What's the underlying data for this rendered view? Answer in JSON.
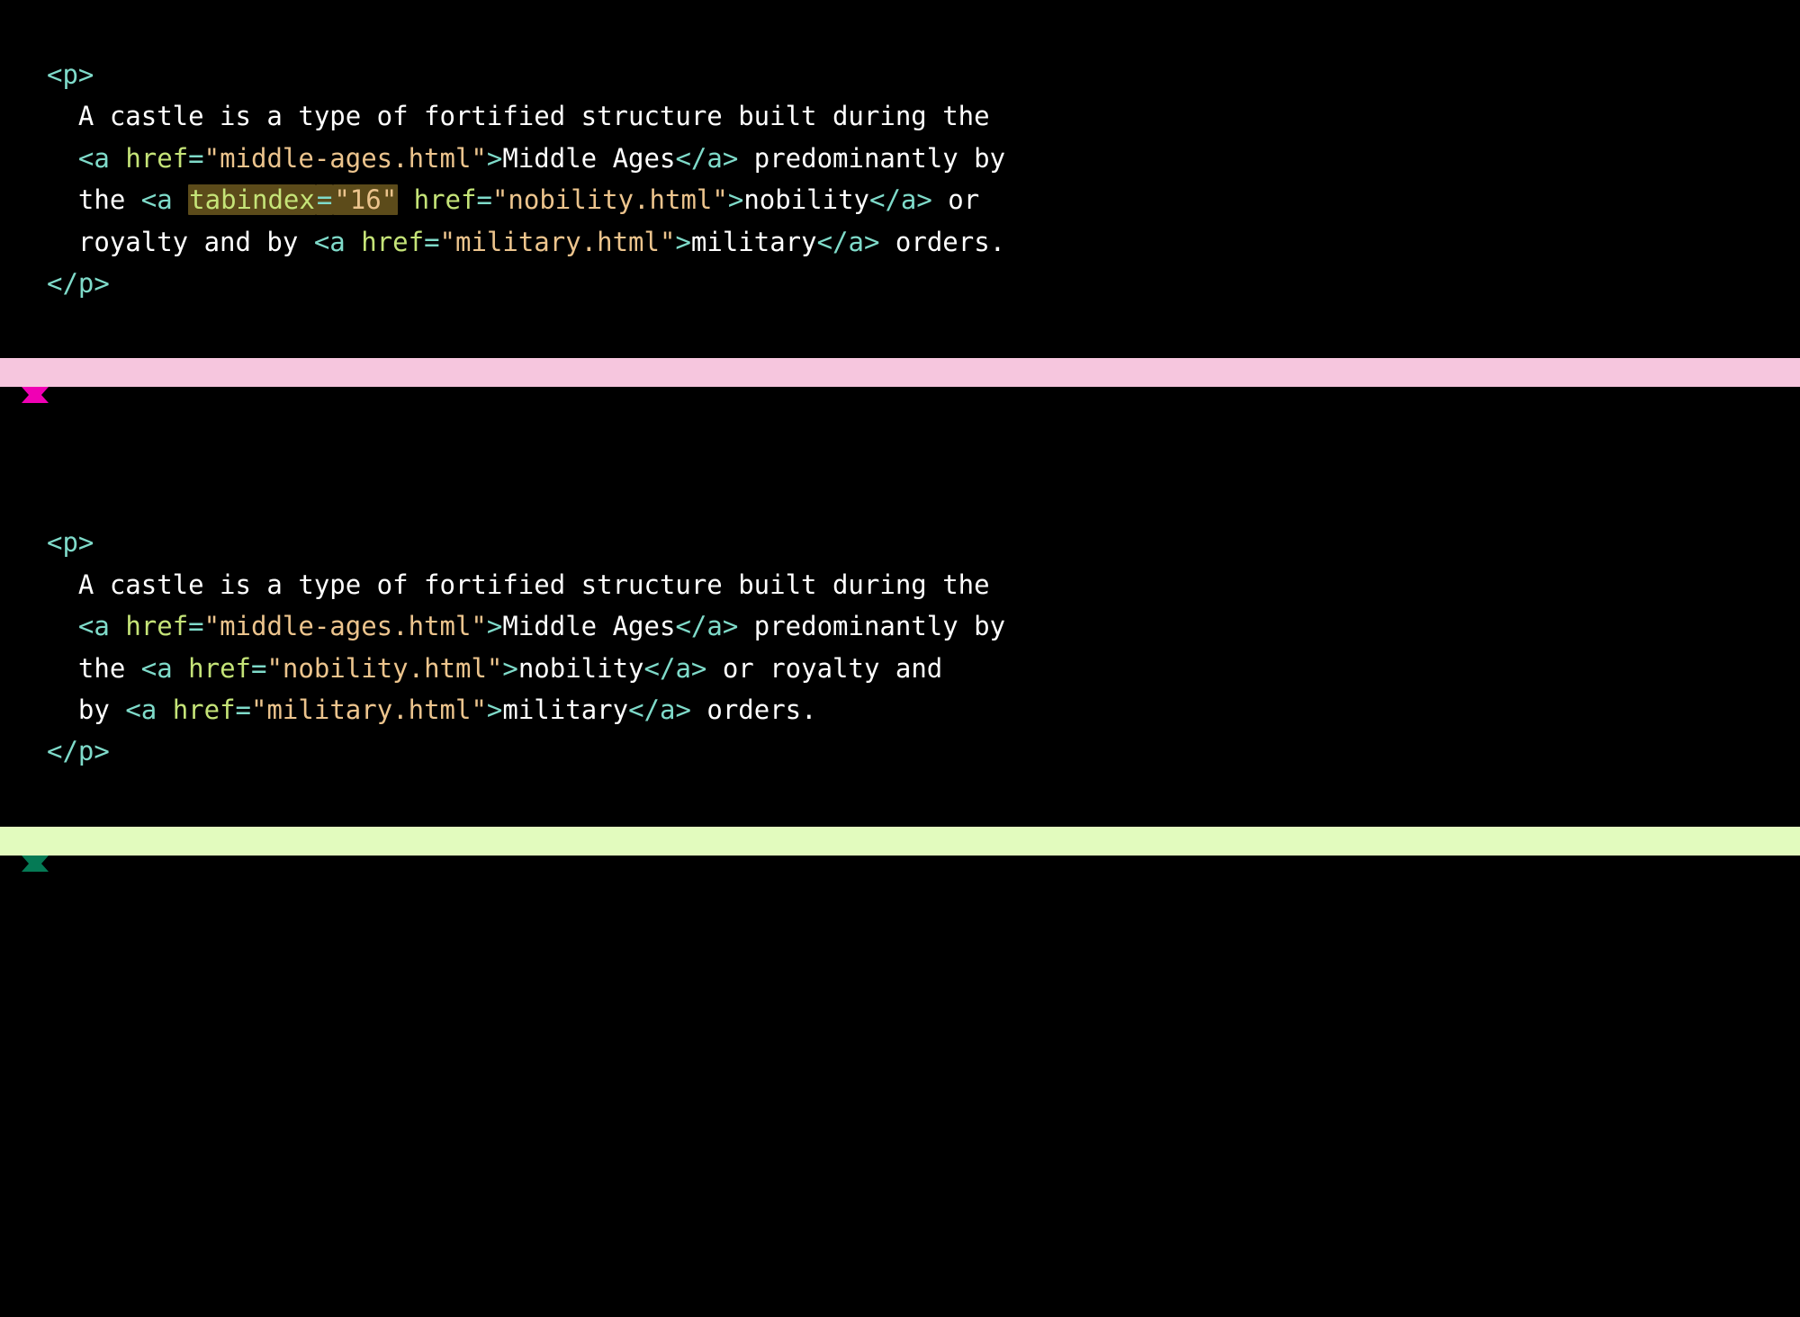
{
  "examples": [
    {
      "id": "bad",
      "divider_color": "pink",
      "marker_color": "#f000b4",
      "tokens": [
        {
          "i": 0,
          "t": "tag",
          "v": "<p>"
        },
        {
          "i": 1,
          "t": "txt",
          "v": "A castle is a type of fortified structure built during the"
        },
        {
          "i": 1,
          "t": "tag",
          "v": "<"
        },
        {
          "i": null,
          "t": "tag",
          "v": "a "
        },
        {
          "i": null,
          "t": "attr",
          "v": "href"
        },
        {
          "i": null,
          "t": "tag",
          "v": "="
        },
        {
          "i": null,
          "t": "str",
          "v": "\"middle-ages.html\""
        },
        {
          "i": null,
          "t": "tag",
          "v": ">"
        },
        {
          "i": null,
          "t": "txt",
          "v": "Middle Ages"
        },
        {
          "i": null,
          "t": "tag",
          "v": "</a>"
        },
        {
          "i": null,
          "t": "txt",
          "v": " predominantly by"
        },
        {
          "i": 1,
          "t": "txt",
          "v": "the "
        },
        {
          "i": null,
          "t": "tag",
          "v": "<"
        },
        {
          "i": null,
          "t": "tag",
          "v": "a "
        },
        {
          "i": null,
          "t": "attr",
          "hl": true,
          "v": "tabindex"
        },
        {
          "i": null,
          "t": "tag",
          "hl": true,
          "v": "="
        },
        {
          "i": null,
          "t": "str",
          "hl": true,
          "v": "\"16\""
        },
        {
          "i": null,
          "t": "txt",
          "v": " "
        },
        {
          "i": null,
          "t": "attr",
          "v": "href"
        },
        {
          "i": null,
          "t": "tag",
          "v": "="
        },
        {
          "i": null,
          "t": "str",
          "v": "\"nobility.html\""
        },
        {
          "i": null,
          "t": "tag",
          "v": ">"
        },
        {
          "i": null,
          "t": "txt",
          "v": "nobility"
        },
        {
          "i": null,
          "t": "tag",
          "v": "</a>"
        },
        {
          "i": null,
          "t": "txt",
          "v": " or"
        },
        {
          "i": 1,
          "t": "txt",
          "v": "royalty and by "
        },
        {
          "i": null,
          "t": "tag",
          "v": "<"
        },
        {
          "i": null,
          "t": "tag",
          "v": "a "
        },
        {
          "i": null,
          "t": "attr",
          "v": "href"
        },
        {
          "i": null,
          "t": "tag",
          "v": "="
        },
        {
          "i": null,
          "t": "str",
          "v": "\"military.html\""
        },
        {
          "i": null,
          "t": "tag",
          "v": ">"
        },
        {
          "i": null,
          "t": "txt",
          "v": "military"
        },
        {
          "i": null,
          "t": "tag",
          "v": "</a>"
        },
        {
          "i": null,
          "t": "txt",
          "v": " orders."
        },
        {
          "i": 0,
          "t": "tag",
          "v": "</p>"
        }
      ]
    },
    {
      "id": "good",
      "divider_color": "green",
      "marker_color": "#057a55",
      "tokens": [
        {
          "i": 0,
          "t": "tag",
          "v": "<p>"
        },
        {
          "i": 1,
          "t": "txt",
          "v": "A castle is a type of fortified structure built during the"
        },
        {
          "i": 1,
          "t": "tag",
          "v": "<"
        },
        {
          "i": null,
          "t": "tag",
          "v": "a "
        },
        {
          "i": null,
          "t": "attr",
          "v": "href"
        },
        {
          "i": null,
          "t": "tag",
          "v": "="
        },
        {
          "i": null,
          "t": "str",
          "v": "\"middle-ages.html\""
        },
        {
          "i": null,
          "t": "tag",
          "v": ">"
        },
        {
          "i": null,
          "t": "txt",
          "v": "Middle Ages"
        },
        {
          "i": null,
          "t": "tag",
          "v": "</a>"
        },
        {
          "i": null,
          "t": "txt",
          "v": " predominantly by"
        },
        {
          "i": 1,
          "t": "txt",
          "v": "the "
        },
        {
          "i": null,
          "t": "tag",
          "v": "<"
        },
        {
          "i": null,
          "t": "tag",
          "v": "a "
        },
        {
          "i": null,
          "t": "attr",
          "v": "href"
        },
        {
          "i": null,
          "t": "tag",
          "v": "="
        },
        {
          "i": null,
          "t": "str",
          "v": "\"nobility.html\""
        },
        {
          "i": null,
          "t": "tag",
          "v": ">"
        },
        {
          "i": null,
          "t": "txt",
          "v": "nobility"
        },
        {
          "i": null,
          "t": "tag",
          "v": "</a>"
        },
        {
          "i": null,
          "t": "txt",
          "v": " or royalty and"
        },
        {
          "i": 1,
          "t": "txt",
          "v": "by "
        },
        {
          "i": null,
          "t": "tag",
          "v": "<"
        },
        {
          "i": null,
          "t": "tag",
          "v": "a "
        },
        {
          "i": null,
          "t": "attr",
          "v": "href"
        },
        {
          "i": null,
          "t": "tag",
          "v": "="
        },
        {
          "i": null,
          "t": "str",
          "v": "\"military.html\""
        },
        {
          "i": null,
          "t": "tag",
          "v": ">"
        },
        {
          "i": null,
          "t": "txt",
          "v": "military"
        },
        {
          "i": null,
          "t": "tag",
          "v": "</a>"
        },
        {
          "i": null,
          "t": "txt",
          "v": " orders."
        },
        {
          "i": 0,
          "t": "tag",
          "v": "</p>"
        }
      ]
    }
  ]
}
